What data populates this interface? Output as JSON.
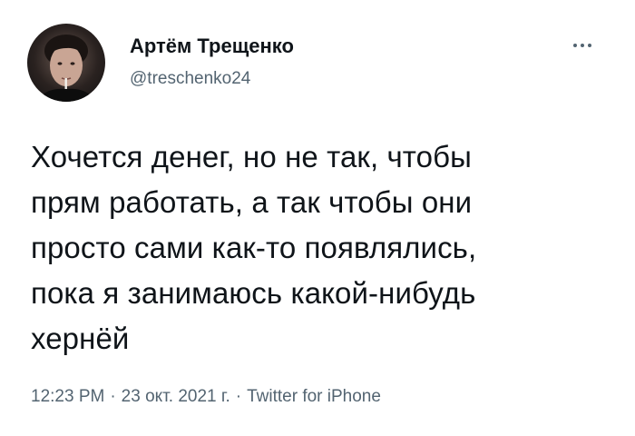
{
  "author": {
    "display_name": "Артём Трещенко",
    "handle": "@treschenko24",
    "avatar_icon": "user-avatar-photo"
  },
  "menu": {
    "icon": "more-horizontal-icon"
  },
  "tweet": {
    "text_lines": [
      "Хочется денег, но не так, чтобы",
      "прям работать, а так чтобы они",
      "просто сами как-то появлялись,",
      "пока я занимаюсь какой-нибудь",
      "хернёй"
    ]
  },
  "meta": {
    "time": "12:23 PM",
    "separator": "·",
    "date": "23 окт. 2021 г.",
    "source": "Twitter for iPhone"
  },
  "colors": {
    "text_primary": "#0f1419",
    "text_secondary": "#536471",
    "background": "#ffffff"
  }
}
